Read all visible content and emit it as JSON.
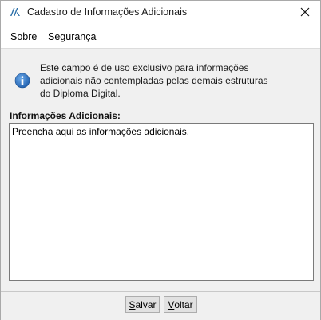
{
  "window": {
    "title": "Cadastro de Informações Adicionais",
    "app_icon": "app-logo-icon",
    "close_icon": "close-icon"
  },
  "menu": {
    "items": [
      {
        "label_pre": "",
        "label_mnemonic": "S",
        "label_post": "obre"
      },
      {
        "label_pre": "Segurança",
        "label_mnemonic": "",
        "label_post": ""
      }
    ]
  },
  "info": {
    "icon": "info-icon",
    "lines": [
      "Este campo é de uso exclusivo para informações",
      "adicionais não contempladas pelas demais estruturas",
      "do Diploma Digital."
    ]
  },
  "field": {
    "label": "Informações Adicionais:",
    "value": "Preencha aqui as informações adicionais."
  },
  "buttons": {
    "save": {
      "mnemonic": "S",
      "rest": "alvar"
    },
    "back": {
      "mnemonic": "V",
      "rest": "oltar"
    }
  },
  "colors": {
    "accent_icon": "#2f6fb7",
    "logo": "#2b6fa8"
  }
}
